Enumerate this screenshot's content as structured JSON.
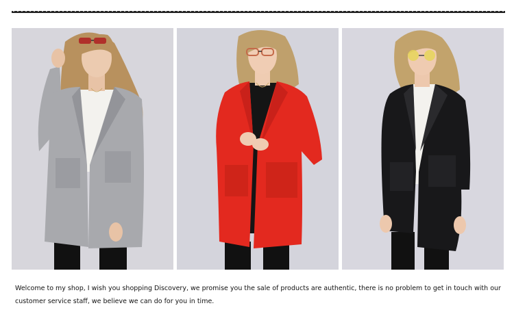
{
  "gallery": {
    "photos": [
      {
        "subject": "model-grey-coat",
        "coat_color": "#a8a9ad",
        "inner_color": "#f3f2ee",
        "lens_color": "#b0302a",
        "background": "#d7d6dc"
      },
      {
        "subject": "model-red-coat",
        "coat_color": "#e3291f",
        "inner_color": "#151515",
        "lens_color": "#c46a4a",
        "background": "#d4d4dc"
      },
      {
        "subject": "model-black-coat",
        "coat_color": "#18181a",
        "inner_color": "#f3f2ee",
        "lens_color": "#e6d65a",
        "background": "#d8d7df"
      }
    ]
  },
  "description": {
    "text": "Welcome to my shop, I wish you shopping Discovery, we promise you the sale of products are authentic, there is no problem to get in touch with our customer service staff, we believe we can do for you in time."
  }
}
